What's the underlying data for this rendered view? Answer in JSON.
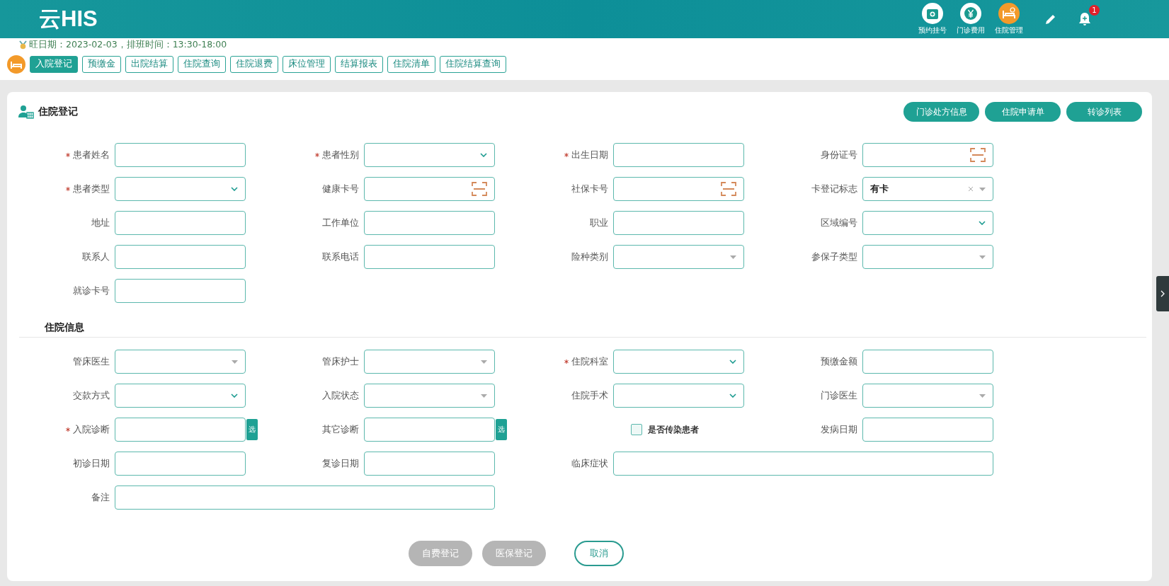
{
  "header": {
    "logo": "云HIS",
    "nav": [
      {
        "label": "预约挂号",
        "selected": false
      },
      {
        "label": "门诊费用",
        "selected": false
      },
      {
        "label": "住院管理",
        "selected": true
      }
    ],
    "notification_count": "1"
  },
  "info_line": "旺日期：2023-02-03，排班时间：13:30-18:00",
  "toolbar": [
    {
      "label": "入院登记",
      "selected": true
    },
    {
      "label": "预缴金",
      "selected": false
    },
    {
      "label": "出院结算",
      "selected": false
    },
    {
      "label": "住院查询",
      "selected": false
    },
    {
      "label": "住院退费",
      "selected": false
    },
    {
      "label": "床位管理",
      "selected": false
    },
    {
      "label": "结算报表",
      "selected": false
    },
    {
      "label": "住院清单",
      "selected": false
    },
    {
      "label": "住院结算查询",
      "selected": false
    }
  ],
  "card": {
    "title": "住院登记",
    "actions": [
      "门诊处方信息",
      "住院申请单",
      "转诊列表"
    ],
    "sections": [
      {
        "fields": [
          {
            "label": "患者姓名",
            "required": true,
            "kind": "text"
          },
          {
            "label": "患者性别",
            "required": true,
            "kind": "select"
          },
          {
            "label": "出生日期",
            "required": true,
            "kind": "text"
          },
          {
            "label": "身份证号",
            "required": false,
            "kind": "scan"
          },
          {
            "label": "患者类型",
            "required": true,
            "kind": "select"
          },
          {
            "label": "健康卡号",
            "required": false,
            "kind": "scan"
          },
          {
            "label": "社保卡号",
            "required": false,
            "kind": "scan"
          },
          {
            "label": "卡登记标志",
            "required": false,
            "kind": "dropdown",
            "value": "有卡",
            "clearable": true
          },
          {
            "label": "地址",
            "required": false,
            "kind": "text"
          },
          {
            "label": "工作单位",
            "required": false,
            "kind": "text"
          },
          {
            "label": "职业",
            "required": false,
            "kind": "text"
          },
          {
            "label": "区域编号",
            "required": false,
            "kind": "select"
          },
          {
            "label": "联系人",
            "required": false,
            "kind": "text"
          },
          {
            "label": "联系电话",
            "required": false,
            "kind": "text"
          },
          {
            "label": "险种类别",
            "required": false,
            "kind": "dropdown"
          },
          {
            "label": "参保子类型",
            "required": false,
            "kind": "dropdown"
          },
          {
            "label": "就诊卡号",
            "required": false,
            "kind": "text"
          }
        ]
      },
      {
        "title": "住院信息",
        "fields": [
          {
            "label": "管床医生",
            "required": false,
            "kind": "dropdown"
          },
          {
            "label": "管床护士",
            "required": false,
            "kind": "dropdown"
          },
          {
            "label": "住院科室",
            "required": true,
            "kind": "select"
          },
          {
            "label": "预缴金额",
            "required": false,
            "kind": "text"
          },
          {
            "label": "交款方式",
            "required": false,
            "kind": "select"
          },
          {
            "label": "入院状态",
            "required": false,
            "kind": "dropdown"
          },
          {
            "label": "住院手术",
            "required": false,
            "kind": "select"
          },
          {
            "label": "门诊医生",
            "required": false,
            "kind": "dropdown"
          },
          {
            "label": "入院诊断",
            "required": true,
            "kind": "choose",
            "button_label": "选"
          },
          {
            "label": "其它诊断",
            "required": false,
            "kind": "choose",
            "button_label": "选"
          },
          {
            "label": "是否传染患者",
            "kind": "checkbox",
            "checked": false
          },
          {
            "label": "发病日期",
            "required": false,
            "kind": "text"
          },
          {
            "label": "初诊日期",
            "required": false,
            "kind": "text"
          },
          {
            "label": "复诊日期",
            "required": false,
            "kind": "text"
          },
          {
            "label": "临床症状",
            "required": false,
            "kind": "wide"
          },
          {
            "label": "备注",
            "required": false,
            "kind": "wide"
          }
        ]
      }
    ],
    "footer_buttons": [
      {
        "label": "自费登记",
        "kind": "primary",
        "disabled": true
      },
      {
        "label": "医保登记",
        "kind": "primary",
        "disabled": true
      },
      {
        "label": "取消",
        "kind": "outline",
        "disabled": false
      }
    ]
  }
}
